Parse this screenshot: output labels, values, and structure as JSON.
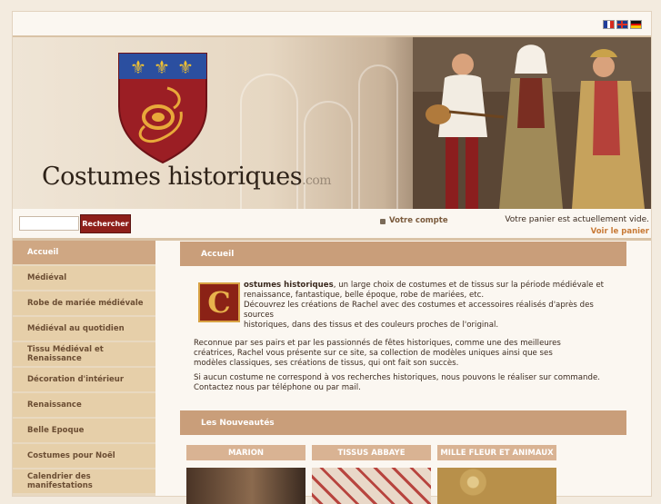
{
  "header": {
    "languages": [
      "fr",
      "en",
      "de"
    ],
    "logo_main": "Costumes historiques",
    "logo_suffix": ".com"
  },
  "search": {
    "placeholder": "",
    "button_label": "Rechercher"
  },
  "account": {
    "link_label": "Votre compte"
  },
  "cart": {
    "status_text": "Votre panier est actuellement vide.",
    "view_link": "Voir le panier"
  },
  "sidebar": {
    "items": [
      {
        "label": "Accueil",
        "active": true
      },
      {
        "label": "Médiéval"
      },
      {
        "label": "Robe de mariée médiévale"
      },
      {
        "label": "Médiéval au quotidien"
      },
      {
        "label": "Tissu Médiéval et Renaissance"
      },
      {
        "label": "Décoration d'intérieur"
      },
      {
        "label": "Renaissance"
      },
      {
        "label": "Belle Epoque"
      },
      {
        "label": "Costumes pour Noël"
      },
      {
        "label": "Calendrier des manifestations"
      }
    ]
  },
  "main": {
    "section_title": "Accueil",
    "dropcap_letter": "C",
    "intro_bold": "ostumes historiques",
    "intro_line1_rest": ", un large choix de costumes et de tissus sur la période médiévale et",
    "intro_line2": "renaissance, fantastique, belle époque, robe de mariées, etc.",
    "intro_line3": "Découvrez les créations de Rachel avec des costumes et accessoires réalisés d'après des sources",
    "intro_line4": "historiques, dans des tissus et des couleurs proches de l'original.",
    "para1_line1": "Reconnue par ses pairs et par les passionnés de fêtes historiques, comme une des meilleures",
    "para1_line2": "créatrices, Rachel vous présente sur ce site, sa collection de modèles uniques ainsi que ses",
    "para1_line3": "modèles classiques, ses créations de tissus, qui ont fait son succès.",
    "para2_line1": "Si aucun costume ne correspond à vos recherches historiques,  nous pouvons le réaliser sur commande.",
    "para2_line2": "Contactez nous par téléphone ou par mail.",
    "news_title": "Les Nouveautés",
    "products": [
      {
        "title": "MARION"
      },
      {
        "title": "TISSUS ABBAYE"
      },
      {
        "title": "MILLE FLEUR ET ANIMAUX"
      }
    ]
  },
  "colors": {
    "accent_red": "#8e1f1a",
    "section_header": "#c99e7a",
    "sidebar_item": "#e6cfa9",
    "link_orange": "#c87a36"
  }
}
